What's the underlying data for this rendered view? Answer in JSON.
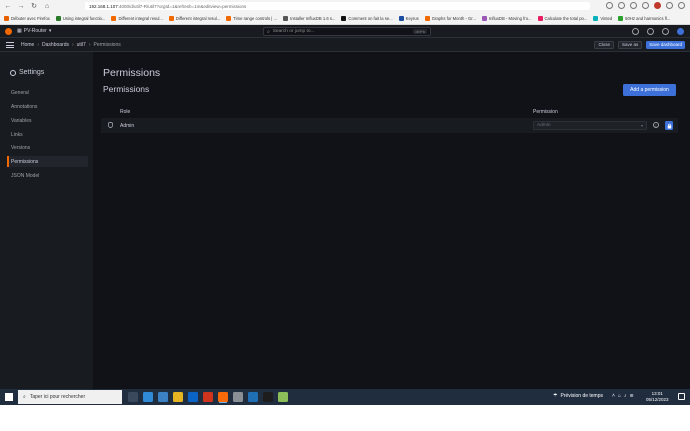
{
  "browser": {
    "url_host": "192.168.1.107",
    "url_rest": ":4000/d/util7-R/util7?orgId=1&refresh=1m&editview=permissions",
    "bookmarks": [
      "Débuter avec Firefox",
      "Using integral functio...",
      "Different integral resul...",
      "Different integral resul...",
      "Time range controls | ...",
      "Installer InfluxDB 1.6 s...",
      "Comment on fait la se...",
      "Keyrus",
      "Graphs for Month - Gr...",
      "InfluxDB - Moving fro...",
      "Calculate the total po...",
      "Vinted",
      "50Hz and harmonics fl..."
    ]
  },
  "grafana": {
    "org_name": "PV-Router",
    "search_placeholder": "Search or jump to...",
    "search_shortcut": "ctrl+k",
    "breadcrumb": {
      "home": "Home",
      "dashboards": "Dashboards",
      "dashboard": "util7",
      "current": "Permissions"
    },
    "buttons": {
      "close": "Close",
      "save_as": "Save as",
      "save_dashboard": "Save dashboard"
    },
    "sidebar": {
      "title": "Settings",
      "items": [
        "General",
        "Annotations",
        "Variables",
        "Links",
        "Versions",
        "Permissions",
        "JSON Model"
      ],
      "active": "Permissions"
    },
    "page_title": "Permissions",
    "section_title": "Permissions",
    "add_permission": "Add a permission",
    "table": {
      "col_role": "Role",
      "col_permission": "Permission",
      "rows": [
        {
          "role": "Admin",
          "permission": "Admin"
        }
      ]
    }
  },
  "taskbar": {
    "search_placeholder": "Taper ici pour rechercher",
    "weather": "Prévision de temps",
    "time": "13:01",
    "date": "05/12/2023"
  }
}
